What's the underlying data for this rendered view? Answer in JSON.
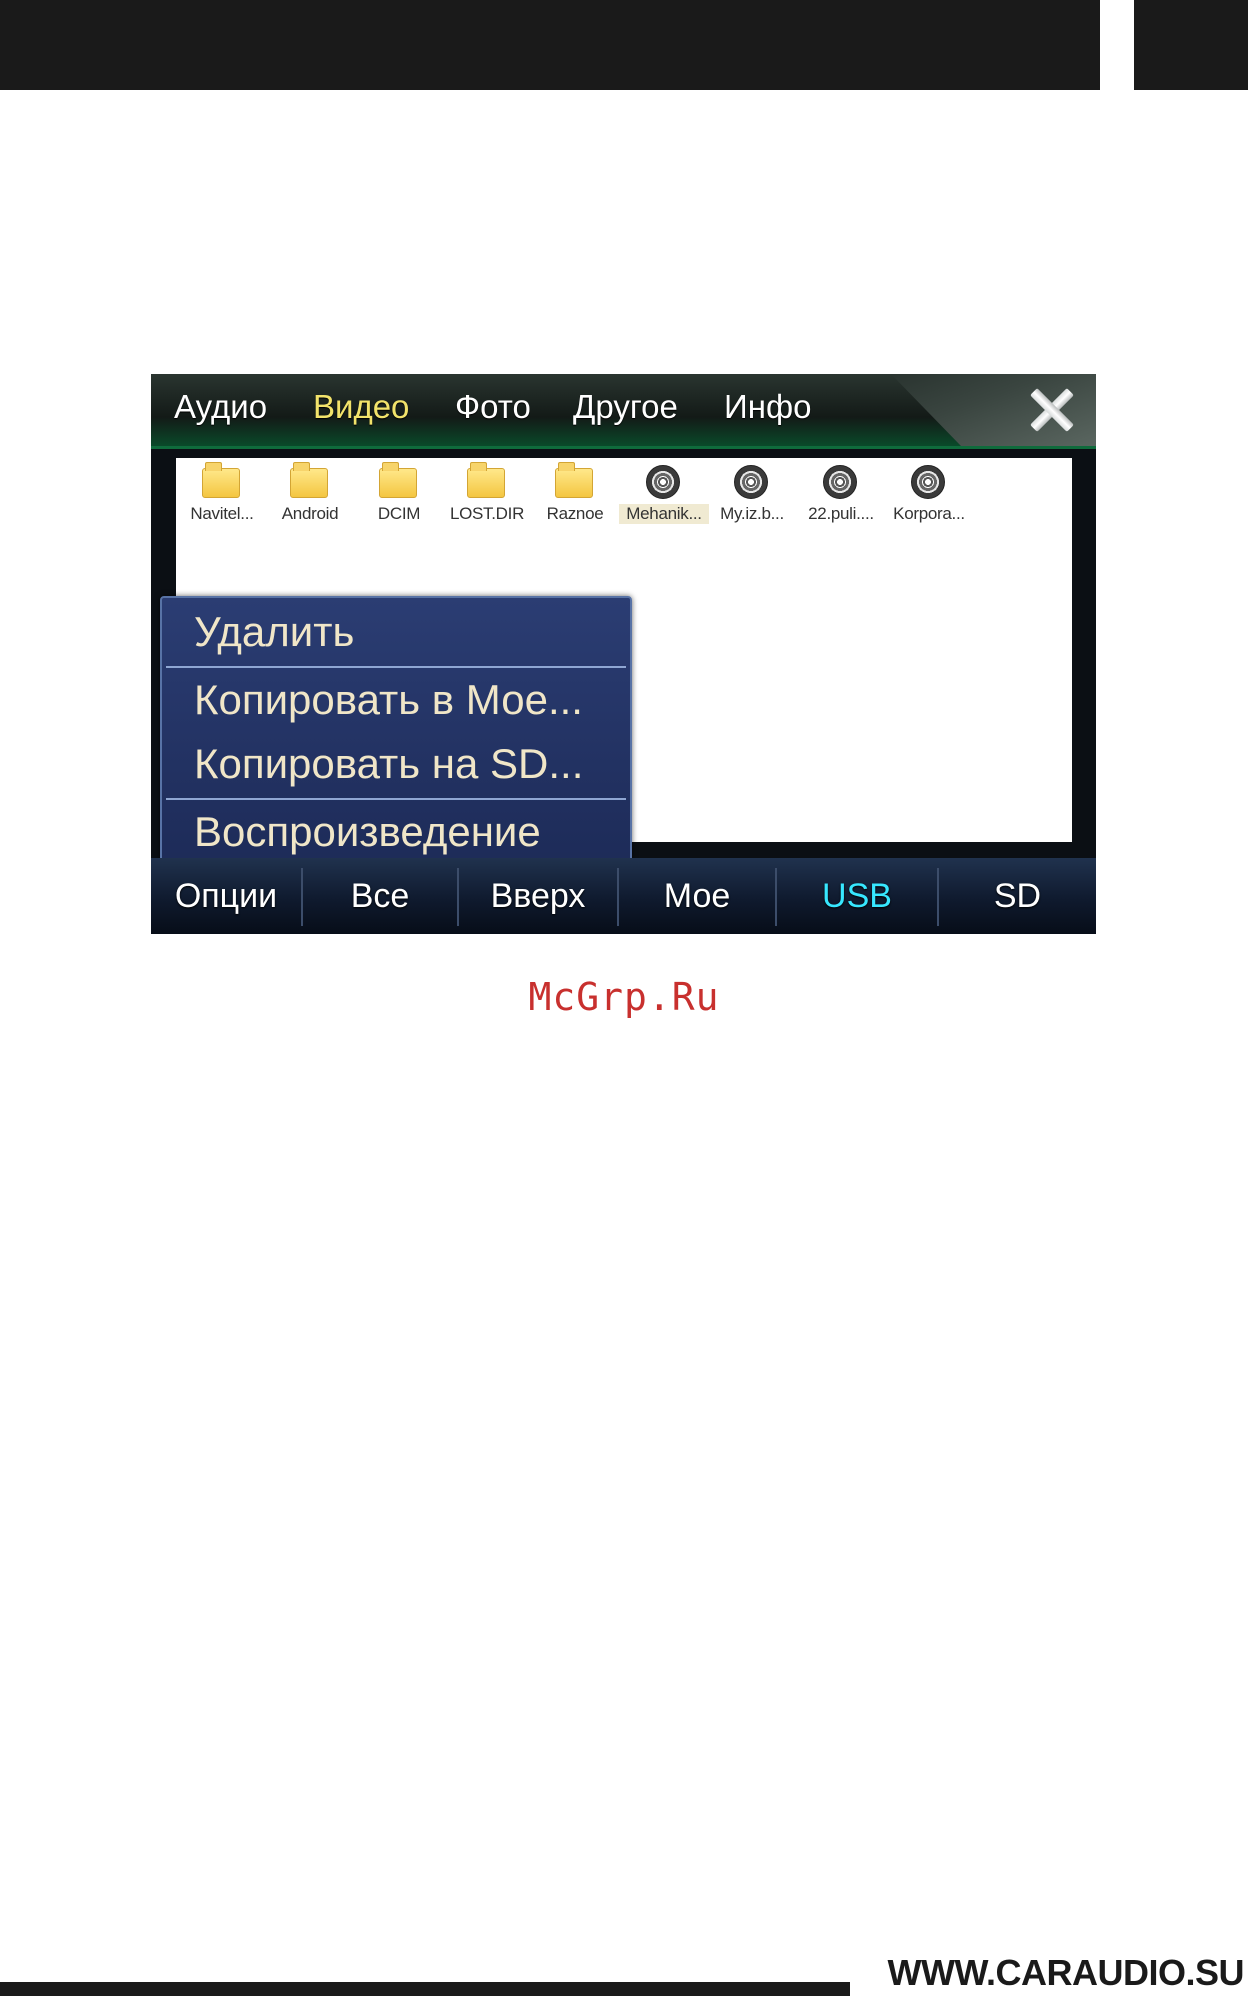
{
  "tabs": [
    {
      "label": "Аудио",
      "active": false
    },
    {
      "label": "Видео",
      "active": true
    },
    {
      "label": "Фото",
      "active": false
    },
    {
      "label": "Другое",
      "active": false
    },
    {
      "label": "Инфо",
      "active": false
    }
  ],
  "files": [
    {
      "label": "Navitel...",
      "icon": "folder-icon"
    },
    {
      "label": "Android",
      "icon": "folder-icon"
    },
    {
      "label": "DCIM",
      "icon": "folder-icon"
    },
    {
      "label": "LOST.DIR",
      "icon": "folder-icon"
    },
    {
      "label": "Raznoe",
      "icon": "folder-icon"
    },
    {
      "label": "Mehanik...",
      "icon": "film-reel-icon",
      "selected": true
    },
    {
      "label": "My.iz.b...",
      "icon": "film-reel-icon"
    },
    {
      "label": "22.puli....",
      "icon": "film-reel-icon"
    },
    {
      "label": "Korpora...",
      "icon": "film-reel-icon"
    }
  ],
  "context_menu": {
    "items": [
      "Удалить",
      "Копировать в Мое...",
      "Копировать на SD...",
      "Воспроизведение"
    ]
  },
  "bottom_buttons": [
    {
      "label": "Опции",
      "active": false
    },
    {
      "label": "Все",
      "active": false
    },
    {
      "label": "Вверх",
      "active": false
    },
    {
      "label": "Мое",
      "active": false
    },
    {
      "label": "USB",
      "active": true
    },
    {
      "label": "SD",
      "active": false
    }
  ],
  "watermark": "McGrp.Ru",
  "footer": {
    "url": "WWW.CARAUDIO.SU"
  },
  "colors": {
    "active_tab": "#f2e36b",
    "active_button": "#37e7ff",
    "menu_bg": "#2b3d73"
  }
}
